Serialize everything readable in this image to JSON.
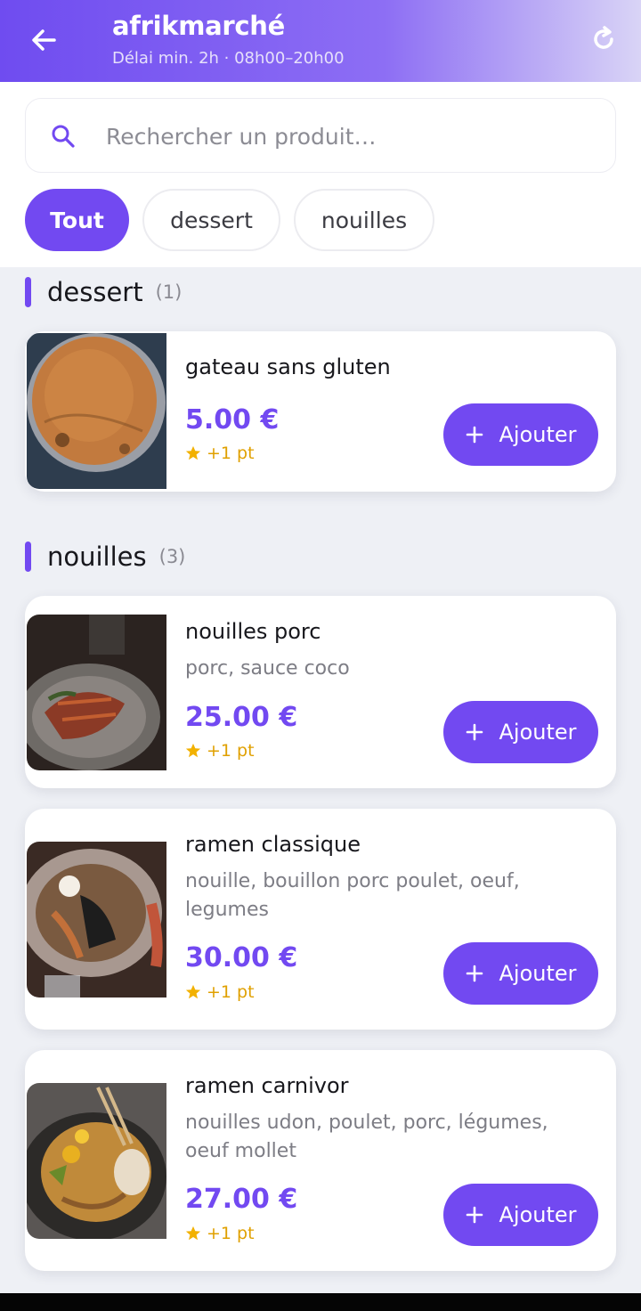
{
  "header": {
    "title": "afrikmarché",
    "subtitle": "Délai min. 2h · 08h00–20h00"
  },
  "search": {
    "placeholder": "Rechercher un produit…"
  },
  "filters": [
    {
      "label": "Tout",
      "active": true
    },
    {
      "label": "dessert",
      "active": false
    },
    {
      "label": "nouilles",
      "active": false
    }
  ],
  "sections": [
    {
      "title": "dessert",
      "count": "(1)",
      "products": [
        {
          "name": "gateau sans gluten",
          "description": "",
          "price": "5.00 €",
          "points": "+1 pt",
          "add_label": "Ajouter"
        }
      ]
    },
    {
      "title": "nouilles",
      "count": "(3)",
      "products": [
        {
          "name": "nouilles porc",
          "description": "porc, sauce coco",
          "price": "25.00 €",
          "points": "+1 pt",
          "add_label": "Ajouter"
        },
        {
          "name": "ramen classique",
          "description": "nouille, bouillon porc poulet, oeuf, legumes",
          "price": "30.00 €",
          "points": "+1 pt",
          "add_label": "Ajouter"
        },
        {
          "name": "ramen carnivor",
          "description": "nouilles udon, poulet, porc, légumes, oeuf mollet",
          "price": "27.00 €",
          "points": "+1 pt",
          "add_label": "Ajouter"
        }
      ]
    }
  ],
  "colors": {
    "accent": "#7249f1",
    "points": "#e0a000"
  },
  "icons": [
    "back-arrow-icon",
    "refresh-icon",
    "search-icon",
    "star-icon",
    "plus-icon"
  ]
}
